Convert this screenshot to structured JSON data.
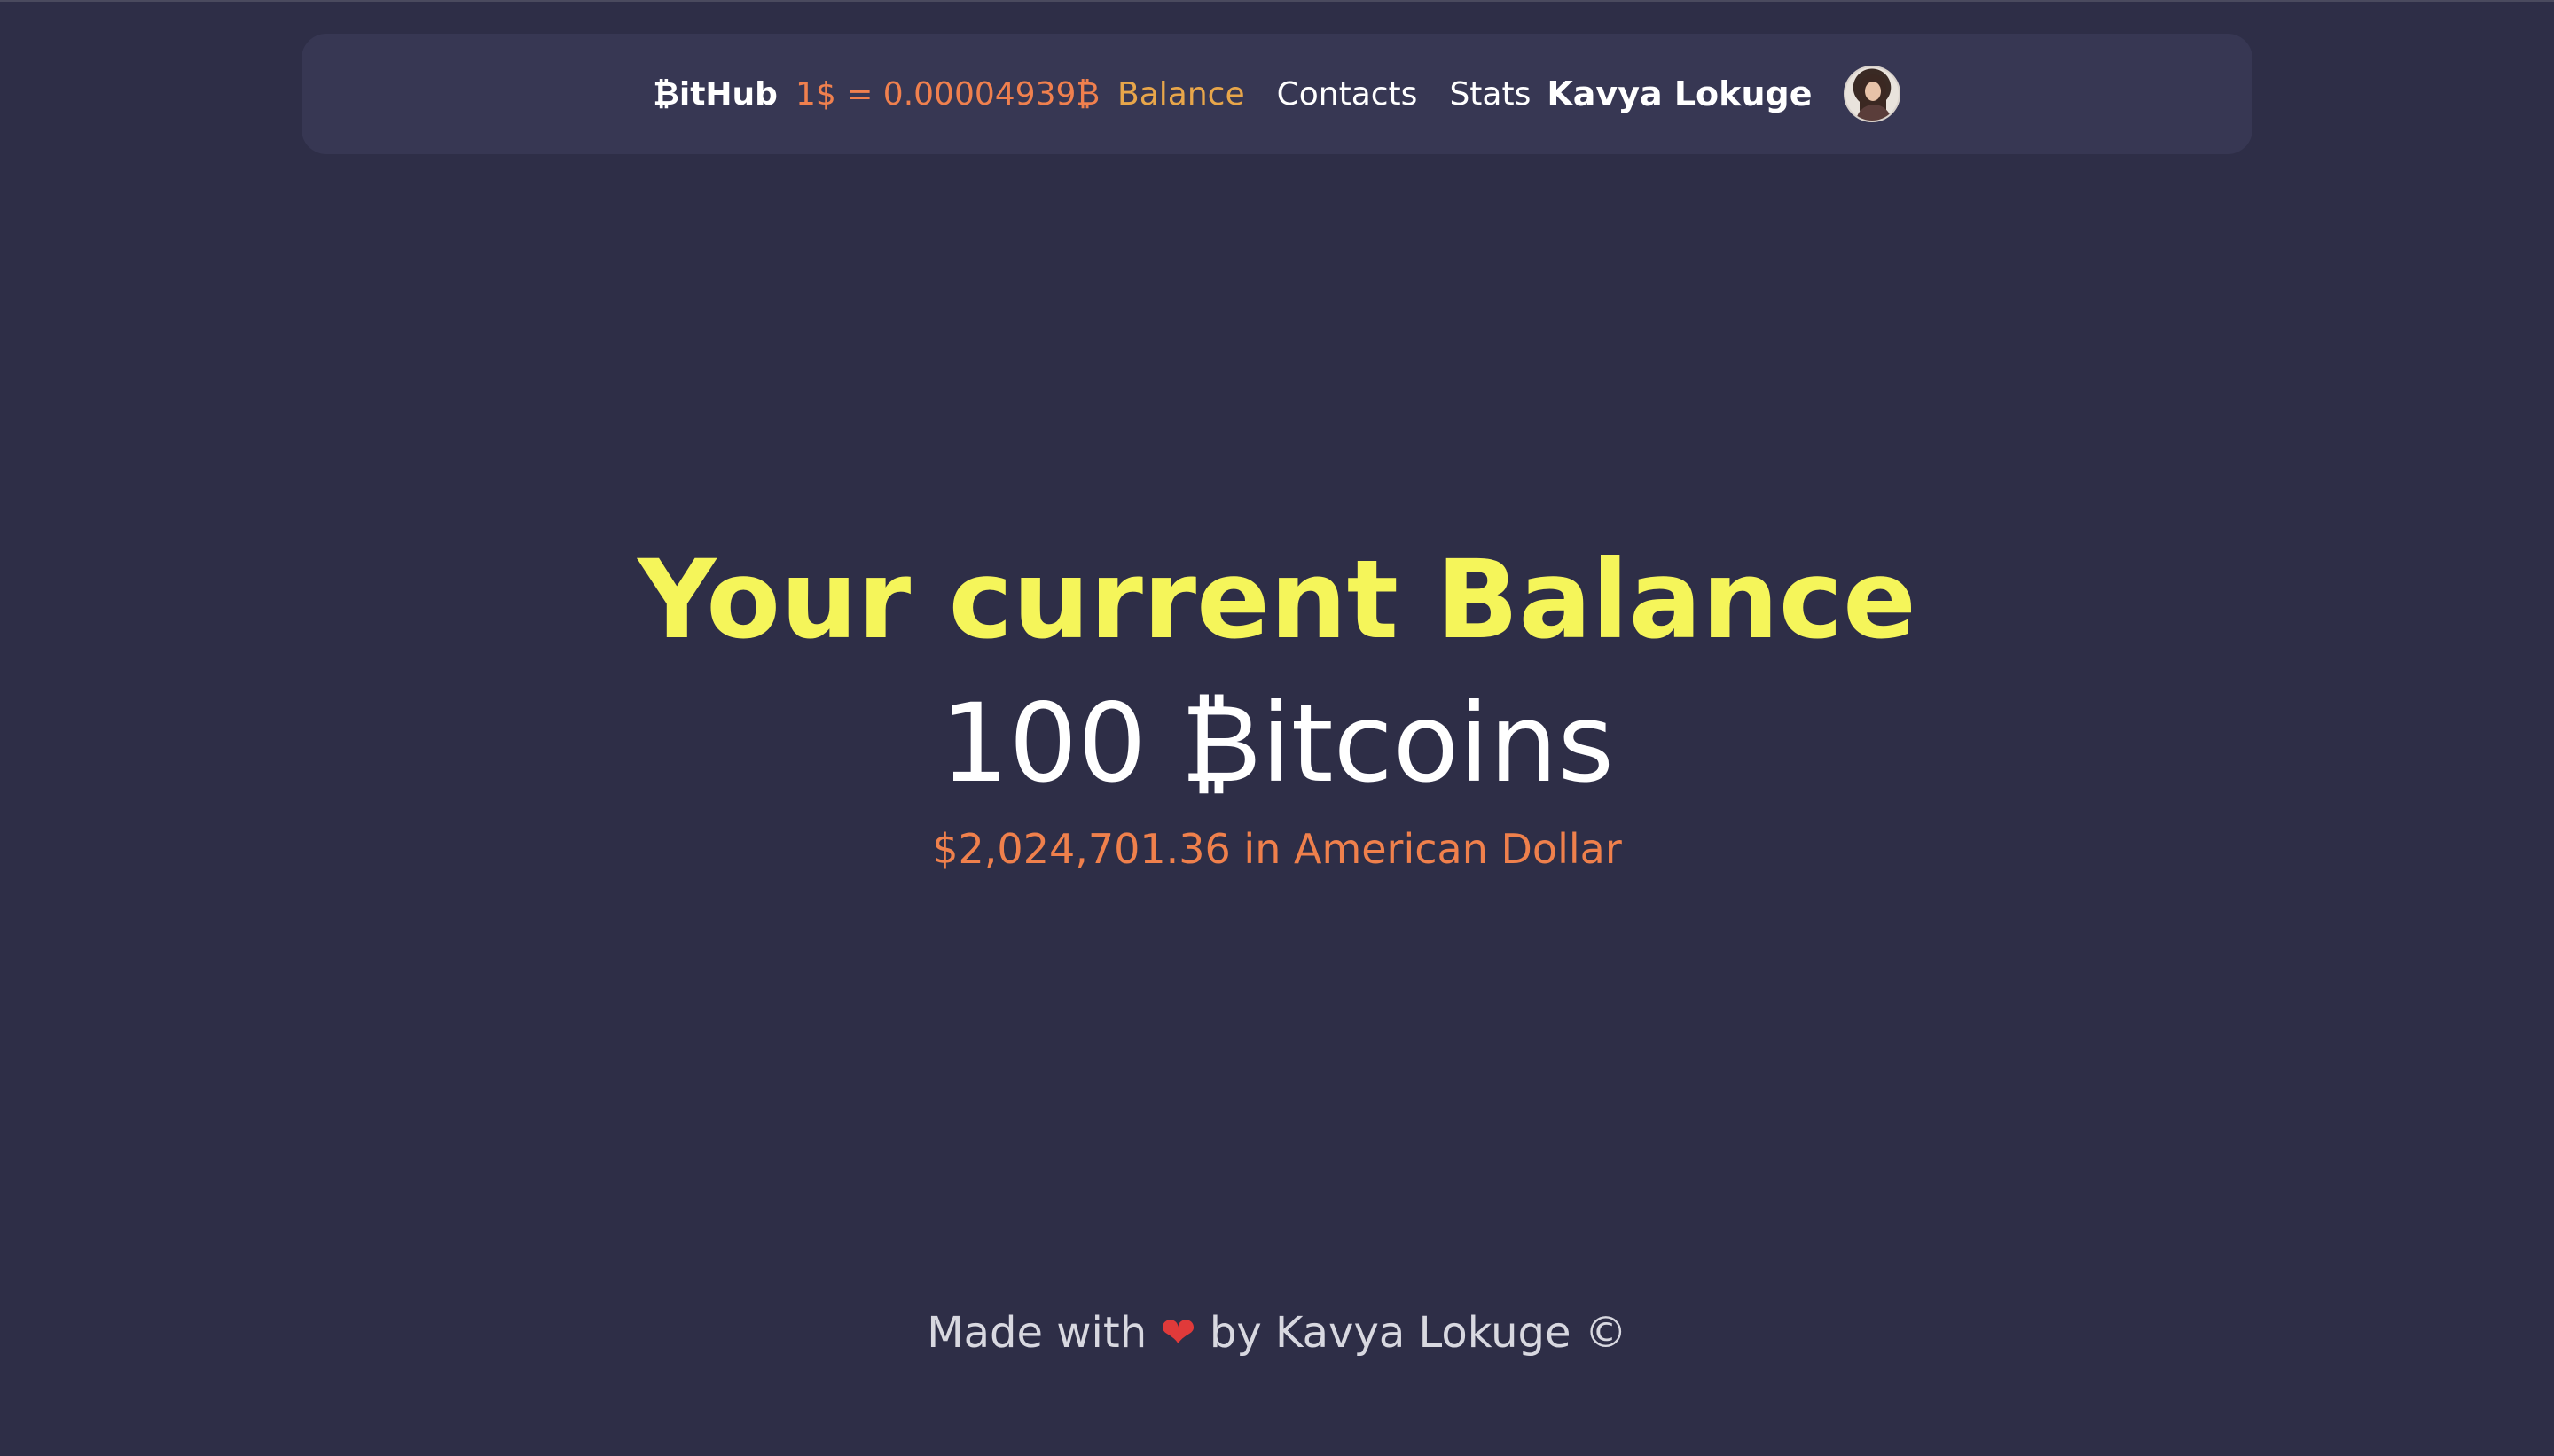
{
  "navbar": {
    "logo": "₿itHub",
    "rate": "1$ = 0.00004939₿",
    "links": [
      "Balance",
      "Contacts",
      "Stats"
    ],
    "username": "Kavya Lokuge"
  },
  "hero": {
    "title": "Your current Balance",
    "amount": "100 ₿itcoins",
    "usd": "$2,024,701.36 in American Dollar"
  },
  "footer": {
    "prefix": "Made with",
    "heart": "❤",
    "suffix": "by Kavya Lokuge ©"
  },
  "colors": {
    "background": "#2e2e47",
    "navbar": "#373753",
    "title_yellow": "#f5f55a",
    "accent_orange": "#ef804c",
    "active_link": "#e8a64a"
  }
}
